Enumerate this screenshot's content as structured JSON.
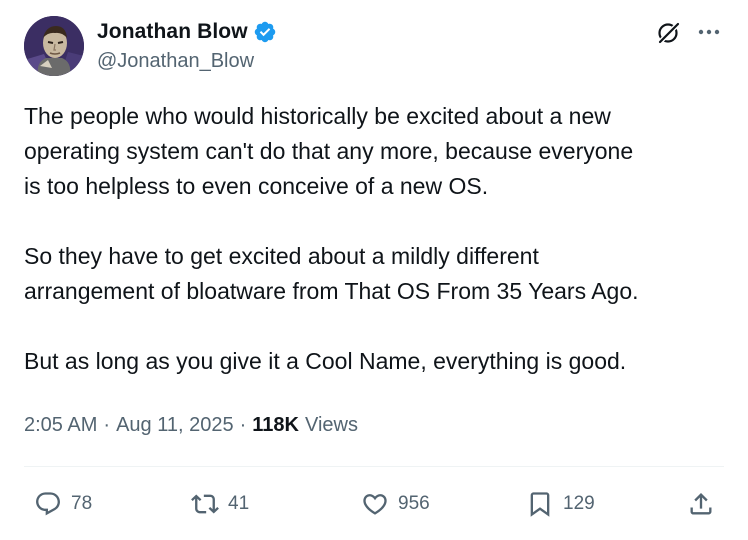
{
  "tweet": {
    "author": {
      "display_name": "Jonathan Blow",
      "handle": "@Jonathan_Blow",
      "verified": true,
      "avatar_icon": "avatar-illustration"
    },
    "paragraphs": [
      "The people who would historically be excited about a new\noperating system can't do that any more, because everyone\nis too helpless to even conceive of a new OS.",
      "So they have to get excited about a mildly different\narrangement of bloatware from That OS From 35 Years Ago.",
      "But as long as you give it a Cool Name, everything is good."
    ],
    "time": "2:05 AM",
    "separator": "·",
    "date": "Aug 11, 2025",
    "views_count": "118K",
    "views_label": "Views",
    "actions": {
      "replies": "78",
      "reposts": "41",
      "likes": "956",
      "bookmarks": "129"
    }
  },
  "colors": {
    "text_primary": "#0f1419",
    "text_secondary": "#536471",
    "verified_blue": "#1d9bf0",
    "divider": "#eff3f4"
  },
  "icons": {
    "grok": "grok-icon",
    "more": "more-dots-icon",
    "reply": "reply-icon",
    "repost": "repost-icon",
    "like": "heart-icon",
    "bookmark": "bookmark-icon",
    "share": "share-icon",
    "verified": "verified-badge-icon"
  }
}
